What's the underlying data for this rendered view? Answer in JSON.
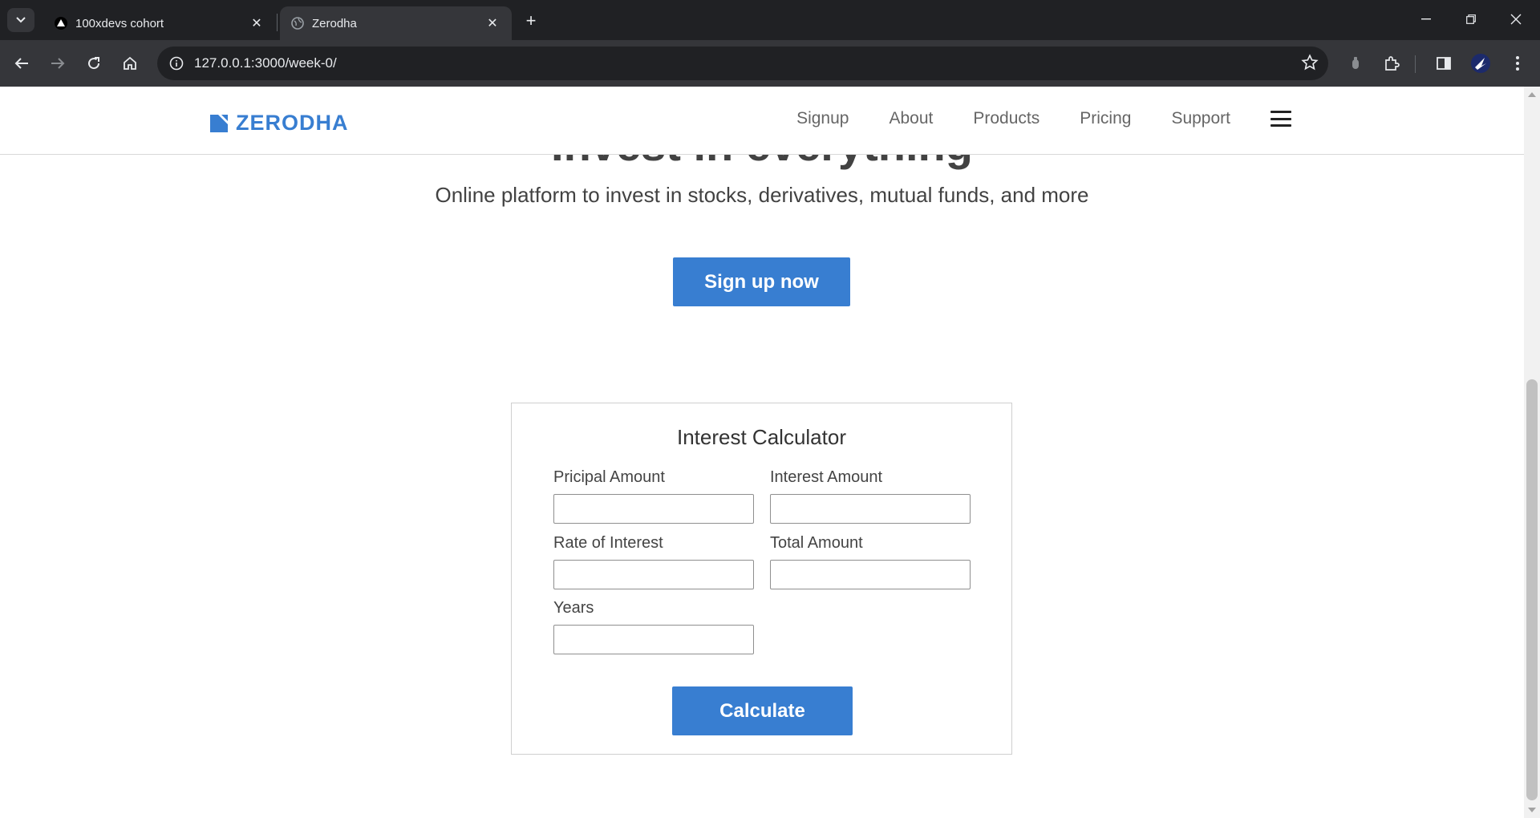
{
  "browser": {
    "tabs": [
      {
        "title": "100xdevs cohort",
        "favicon": "triangle-icon",
        "active": false
      },
      {
        "title": "Zerodha",
        "favicon": "globe-icon",
        "active": true
      }
    ],
    "url": "127.0.0.1:3000/week-0/"
  },
  "nav": {
    "brand": "ZERODHA",
    "links": [
      "Signup",
      "About",
      "Products",
      "Pricing",
      "Support"
    ]
  },
  "hero": {
    "title": "Invest in everything",
    "subtitle": "Online platform to invest in stocks, derivatives, mutual funds, and more",
    "cta": "Sign up now"
  },
  "calculator": {
    "title": "Interest Calculator",
    "principal_label": "Pricipal Amount",
    "interest_label": "Interest Amount",
    "rate_label": "Rate of Interest",
    "total_label": "Total Amount",
    "years_label": "Years",
    "principal_value": "",
    "interest_value": "",
    "rate_value": "",
    "total_value": "",
    "years_value": "",
    "button": "Calculate"
  },
  "colors": {
    "brand": "#387ed1",
    "chrome_dark": "#202124",
    "chrome_toolbar": "#35363a"
  }
}
